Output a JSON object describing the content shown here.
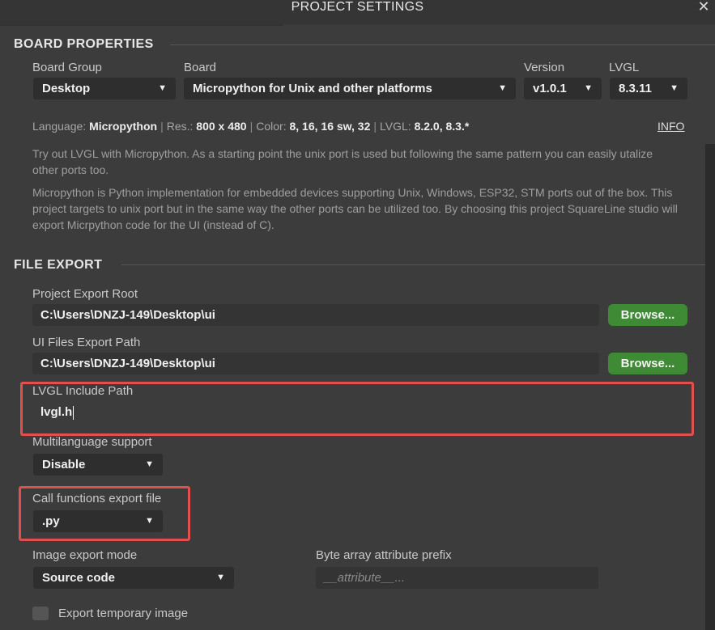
{
  "window": {
    "title": "PROJECT SETTINGS",
    "close_glyph": "✕"
  },
  "board_properties": {
    "title": "BOARD PROPERTIES",
    "board_group": {
      "label": "Board Group",
      "value": "Desktop"
    },
    "board": {
      "label": "Board",
      "value": "Micropython for Unix and other platforms"
    },
    "version": {
      "label": "Version",
      "value": "v1.0.1"
    },
    "lvgl": {
      "label": "LVGL",
      "value": "8.3.11"
    },
    "info": {
      "language_label": "Language:",
      "language_value": "Micropython",
      "res_label": "Res.:",
      "res_value": "800 x 480",
      "color_label": "Color:",
      "color_value": "8, 16, 16 sw, 32",
      "lvgl_label": "LVGL:",
      "lvgl_value": "8.2.0, 8.3.*",
      "separator": "|",
      "link": "INFO"
    },
    "description_1": "Try out LVGL with Micropython. As a starting point the unix port is used but following the same pattern you can easily utalize other ports too.",
    "description_2": "Micropython is Python implementation for embedded devices supporting Unix, Windows, ESP32, STM ports out of the box. This project targets to unix port but in the same way the other ports can be utilized too. By choosing this project SquareLine studio will export Micrpython code for the UI (instead of C)."
  },
  "file_export": {
    "title": "FILE EXPORT",
    "project_export_root": {
      "label": "Project Export Root",
      "value": "C:\\Users\\DNZJ-149\\Desktop\\ui",
      "button": "Browse..."
    },
    "ui_files_export_path": {
      "label": "UI Files Export Path",
      "value": "C:\\Users\\DNZJ-149\\Desktop\\ui",
      "button": "Browse..."
    },
    "lvgl_include_path": {
      "label": "LVGL Include Path",
      "value": "lvgl.h"
    },
    "multilanguage": {
      "label": "Multilanguage support",
      "value": "Disable"
    },
    "call_functions": {
      "label": "Call functions export file",
      "value": ".py"
    },
    "image_export_mode": {
      "label": "Image export mode",
      "value": "Source code"
    },
    "byte_array_prefix": {
      "label": "Byte array attribute prefix",
      "placeholder": "__attribute__..."
    },
    "export_temp_image": {
      "label": "Export temporary image"
    }
  },
  "icons": {
    "caret": "caret-down-icon",
    "close": "close-icon"
  },
  "colors": {
    "accent_green": "#3f8a34",
    "highlight_red": "#e05050",
    "background": "#3c3c3c"
  }
}
